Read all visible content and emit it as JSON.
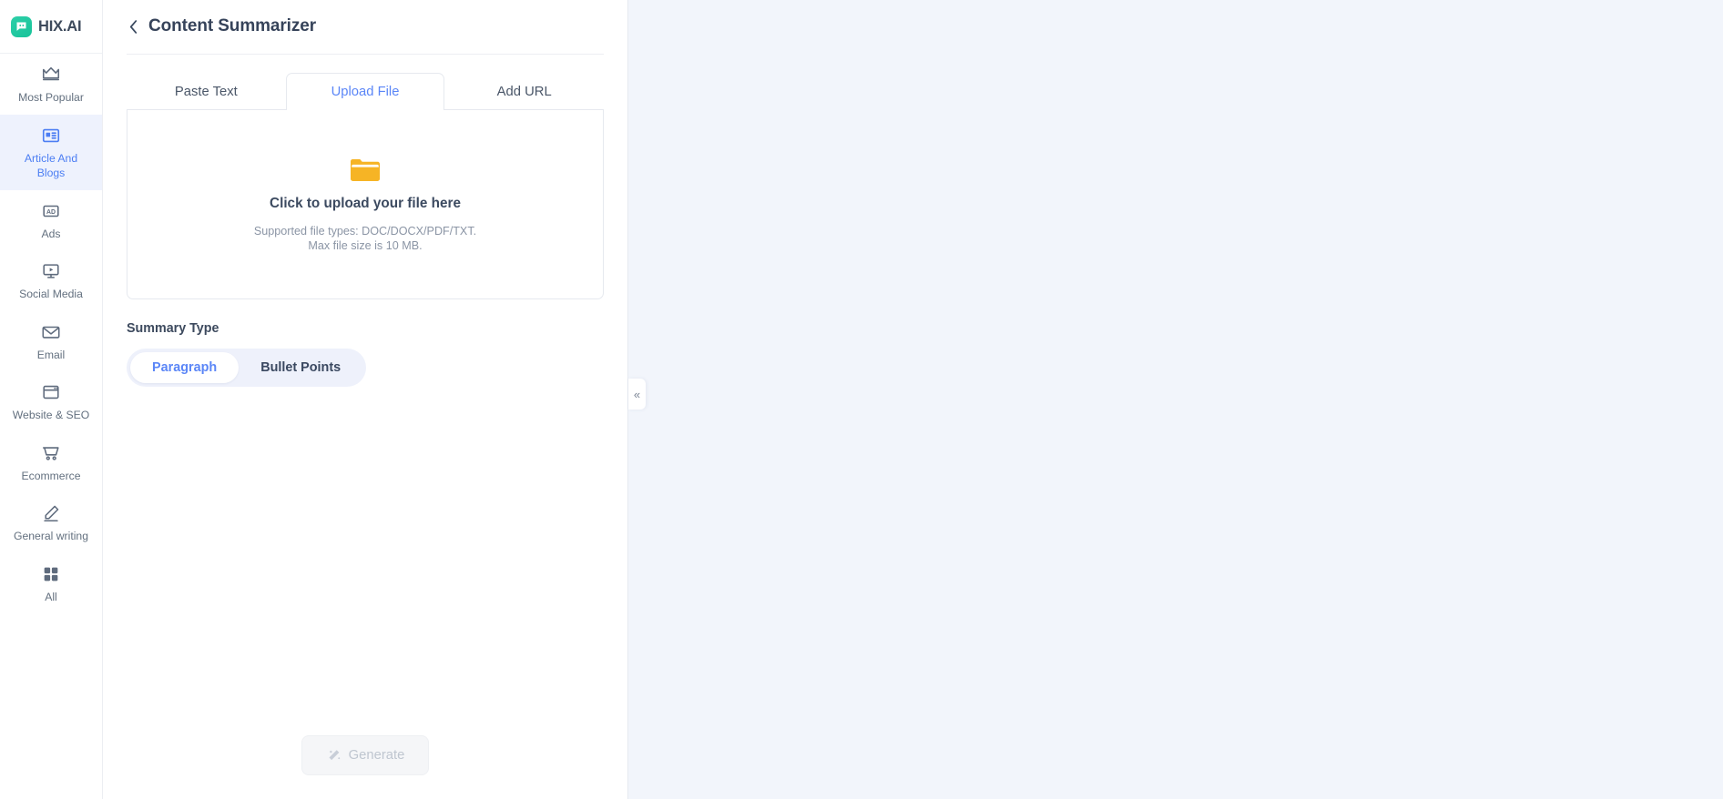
{
  "brand": {
    "name": "HIX.AI",
    "logo_icon": "chat-bubble-icon",
    "accent_color": "#17c39a"
  },
  "sidebar": {
    "items": [
      {
        "label": "Most Popular",
        "icon": "crown-icon",
        "active": false
      },
      {
        "label": "Article And Blogs",
        "icon": "article-icon",
        "active": true
      },
      {
        "label": "Ads",
        "icon": "ad-badge-icon",
        "active": false
      },
      {
        "label": "Social Media",
        "icon": "monitor-play-icon",
        "active": false
      },
      {
        "label": "Email",
        "icon": "envelope-icon",
        "active": false
      },
      {
        "label": "Website & SEO",
        "icon": "browser-window-icon",
        "active": false
      },
      {
        "label": "Ecommerce",
        "icon": "shopping-cart-icon",
        "active": false
      },
      {
        "label": "General writing",
        "icon": "pencil-icon",
        "active": false
      },
      {
        "label": "All",
        "icon": "grid-icon",
        "active": false
      }
    ],
    "active_highlight_color": "#eef2fd",
    "active_text_color": "#4c7ef3"
  },
  "panel": {
    "title": "Content Summarizer",
    "back_icon": "chevron-left-icon",
    "tabs": [
      {
        "label": "Paste Text",
        "active": false
      },
      {
        "label": "Upload File",
        "active": true
      },
      {
        "label": "Add URL",
        "active": false
      }
    ],
    "active_tab_color": "#5b86f7",
    "upload": {
      "icon": "folder-icon",
      "icon_color": "#f5b325",
      "title": "Click to upload your file here",
      "hint_line_1": "Supported file types: DOC/DOCX/PDF/TXT.",
      "hint_line_2": "Max file size is 10 MB."
    },
    "summary_type": {
      "label": "Summary Type",
      "options": [
        {
          "label": "Paragraph",
          "selected": true
        },
        {
          "label": "Bullet Points",
          "selected": false
        }
      ]
    },
    "generate": {
      "label": "Generate",
      "icon": "magic-wand-icon",
      "disabled": true
    }
  },
  "collapse_handle": {
    "glyph": "«",
    "icon": "chevron-double-left-icon"
  }
}
